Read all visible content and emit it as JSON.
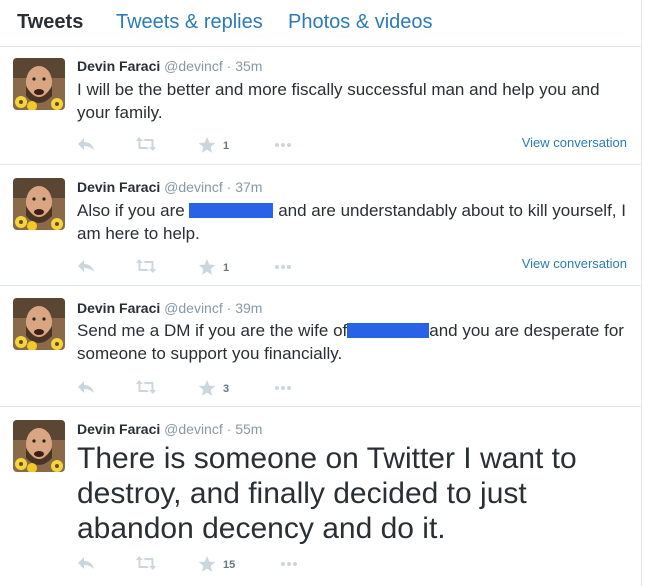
{
  "tabs": [
    {
      "label": "Tweets",
      "active": true
    },
    {
      "label": "Tweets & replies",
      "active": false
    },
    {
      "label": "Photos & videos",
      "active": false
    }
  ],
  "tweets": [
    {
      "name": "Devin Faraci",
      "handle": "@devincf",
      "separator": "·",
      "time": "35m",
      "text": [
        "I will be the better and more fiscally successful man and help you and your family."
      ],
      "favorites": "1",
      "view_conversation": "View conversation"
    },
    {
      "name": "Devin Faraci",
      "handle": "@devincf",
      "separator": "·",
      "time": "37m",
      "text": [
        "Also if you are",
        "and are understandably about to kill yourself, I am here to help."
      ],
      "favorites": "1",
      "view_conversation": "View conversation"
    },
    {
      "name": "Devin Faraci",
      "handle": "@devincf",
      "separator": "·",
      "time": "39m",
      "text": [
        "Send me a DM if you are the wife of",
        "and you are desperate for someone to support you financially."
      ],
      "favorites": "3"
    },
    {
      "name": "Devin Faraci",
      "handle": "@devincf",
      "separator": "·",
      "time": "55m",
      "text": [
        "There is someone on Twitter I want to destroy, and finally decided to just abandon decency and do it."
      ],
      "favorites": "15"
    }
  ],
  "icons": {
    "reply": "reply-icon",
    "retweet": "retweet-icon",
    "favorite": "star-icon",
    "more": "more-icon"
  },
  "colors": {
    "link": "#2b7bb9",
    "muted": "#8899a6",
    "icon": "#ccd6dd",
    "redaction": "#2a62e7"
  }
}
